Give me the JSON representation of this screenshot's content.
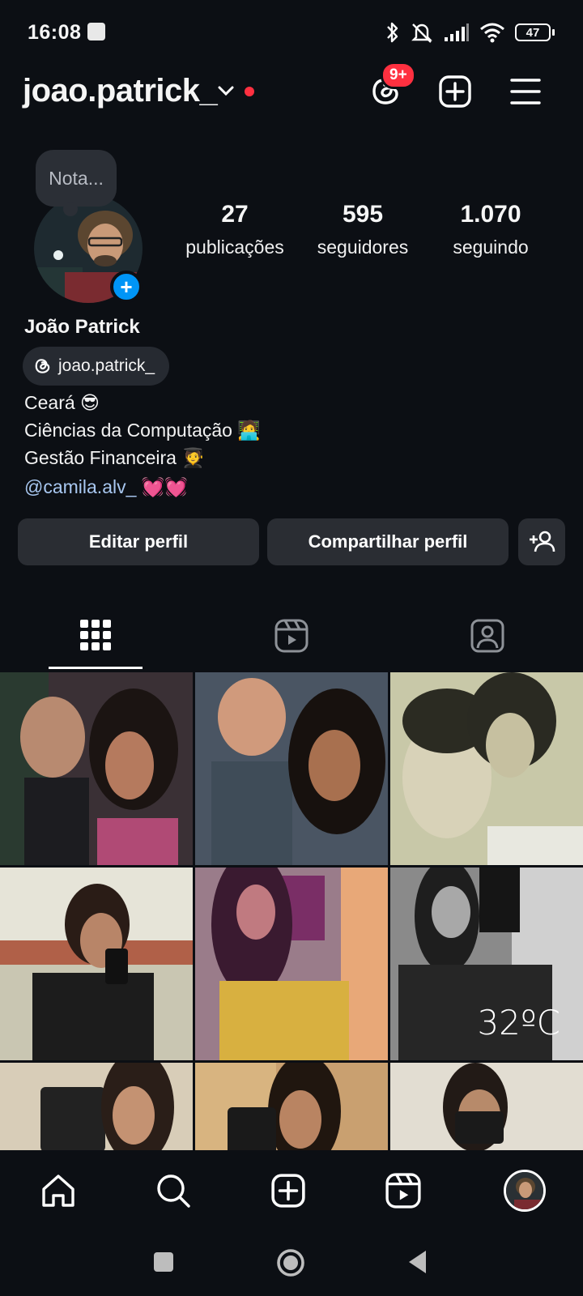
{
  "status_bar": {
    "time": "16:08",
    "battery": "47"
  },
  "header": {
    "username": "joao.patrick_",
    "threads_badge": "9+"
  },
  "profile": {
    "note": "Nota...",
    "stats": [
      {
        "value": "27",
        "label": "publicações"
      },
      {
        "value": "595",
        "label": "seguidores"
      },
      {
        "value": "1.070",
        "label": "seguindo"
      }
    ],
    "full_name": "João Patrick",
    "threads_handle": "joao.patrick_",
    "bio": [
      "Ceará 😎",
      "Ciências da Computação 🧑‍💻",
      "Gestão Financeira 🧑‍🎓"
    ],
    "bio_mention": "@camila.alv_",
    "bio_mention_emoji": "💓💓"
  },
  "buttons": {
    "edit": "Editar perfil",
    "share": "Compartilhar perfil"
  },
  "grid": {
    "temperature_overlay": "32ºC"
  },
  "icons": {
    "threads": "threads-icon",
    "new_post": "plus-square-icon",
    "menu": "hamburger-menu-icon",
    "grid_tab": "grid-icon",
    "reels_tab": "reels-icon",
    "tagged_tab": "tagged-person-icon",
    "home": "home-icon",
    "search": "search-icon",
    "reels": "reels-icon"
  },
  "colors": {
    "background": "#0c0f14",
    "accent": "#0095f6",
    "notification": "#ff3040",
    "button": "#2a2d33"
  }
}
